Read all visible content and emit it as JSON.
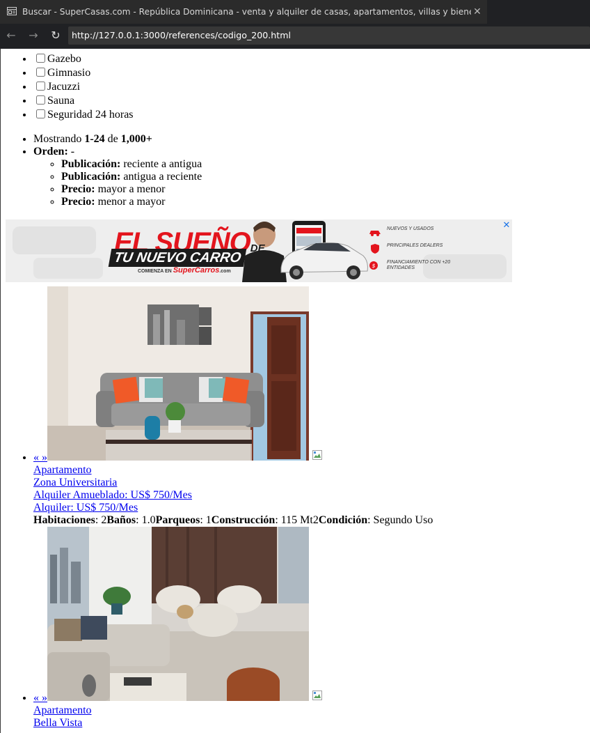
{
  "browser": {
    "tab_title": "Buscar - SuperCasas.com - República Dominicana - venta y alquiler de casas, apartamentos, villas y bienes raíces",
    "close_glyph": "✕",
    "back_glyph": "←",
    "forward_glyph": "→",
    "reload_glyph": "↻",
    "url": "http://127.0.0.1:3000/references/codigo_200.html"
  },
  "amenities": [
    "Gazebo",
    "Gimnasio",
    "Jacuzzi",
    "Sauna",
    "Seguridad 24 horas"
  ],
  "results": {
    "showing_prefix": "Mostrando ",
    "showing_range": "1-24",
    "showing_of": " de ",
    "showing_total": "1,000+",
    "order_label": "Orden:",
    "order_value": " -",
    "sort_options": [
      {
        "label": "Publicación:",
        "value": " reciente a antigua"
      },
      {
        "label": "Publicación:",
        "value": " antigua a reciente"
      },
      {
        "label": "Precio:",
        "value": " mayor a menor"
      },
      {
        "label": "Precio:",
        "value": " menor a mayor"
      }
    ]
  },
  "ad": {
    "headline_1": "EL SUEÑO",
    "headline_1_suffix": "DE",
    "headline_2": "TU NUEVO CARRO",
    "tagline": "COMIENZA EN",
    "brand": "SuperCarros",
    "brand_suffix": ".com",
    "features": [
      "NUEVOS Y USADOS",
      "PRINCIPALES DEALERS",
      "FINANCIAMIENTO CON +20 ENTIDADES"
    ],
    "close_glyph": "✕"
  },
  "listings": [
    {
      "nav": "« »",
      "type": "Apartamento",
      "location": "Zona Universitaria",
      "price_furnished": "Alquiler Amueblado: US$ 750/Mes",
      "price": "Alquiler: US$ 750/Mes",
      "rooms_label": "Habitaciones",
      "rooms": ": 2",
      "baths_label": "Baños",
      "baths": ": 1.0",
      "parking_label": "Parqueos",
      "parking": ": 1",
      "size_label": "Construcción",
      "size": ": 115 Mt2",
      "condition_label": "Condición",
      "condition": ": Segundo Uso"
    },
    {
      "nav": "« »",
      "type": "Apartamento",
      "location": "Bella Vista"
    }
  ]
}
